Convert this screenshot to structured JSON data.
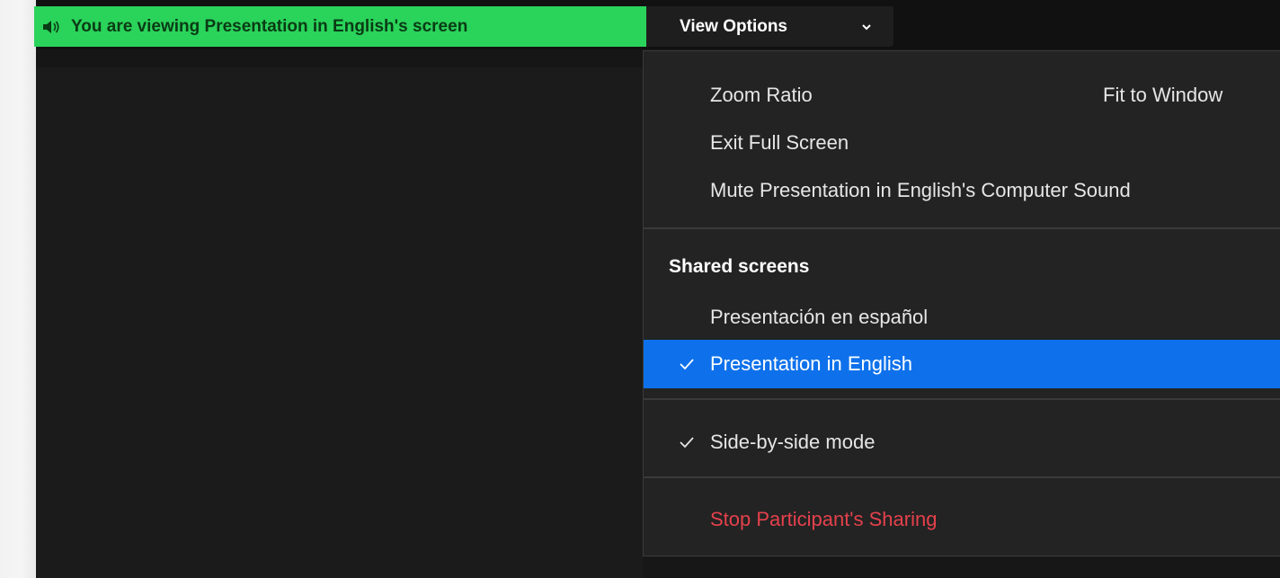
{
  "banner": {
    "text": "You are viewing Presentation in English's screen",
    "icon": "speaker-icon",
    "color": "#2ad35a"
  },
  "view_options": {
    "label": "View Options",
    "icon": "chevron-down-icon"
  },
  "menu": {
    "zoom_ratio": {
      "label": "Zoom Ratio",
      "value": "Fit to Window"
    },
    "exit_full_screen": {
      "label": "Exit Full Screen"
    },
    "mute_sound": {
      "label": "Mute Presentation in English's Computer Sound"
    },
    "shared_screens_header": "Shared screens",
    "shared_screens": [
      {
        "label": "Presentación en español",
        "checked": false
      },
      {
        "label": "Presentation in English",
        "checked": true
      }
    ],
    "side_by_side": {
      "label": "Side-by-side mode",
      "checked": true
    },
    "stop_sharing": {
      "label": "Stop Participant's Sharing"
    }
  },
  "colors": {
    "selected": "#0e71eb",
    "danger": "#e5414c",
    "menu_bg": "#232323"
  }
}
